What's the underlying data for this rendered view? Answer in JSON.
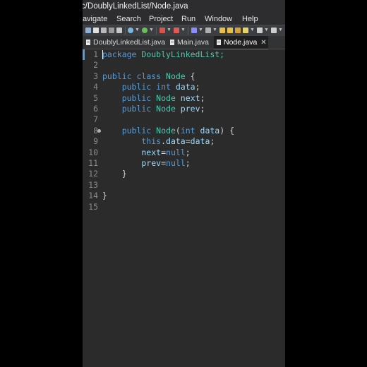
{
  "window": {
    "title": "c/DoublyLinkedList/Node.java"
  },
  "menu": [
    "Navigate",
    "Search",
    "Project",
    "Run",
    "Window",
    "Help"
  ],
  "tabs": [
    {
      "label": "DoublyLinkedList.java",
      "active": false
    },
    {
      "label": "Main.java",
      "active": false
    },
    {
      "label": "Node.java",
      "active": true,
      "close": "✕"
    }
  ],
  "toolbar": {
    "icons": [
      "save-icon",
      "new-icon",
      "open-icon",
      "print-icon",
      "build-icon",
      "run-icon",
      "debug-icon",
      "stop-icon",
      "search-icon",
      "edit-icon",
      "pen-icon"
    ]
  },
  "colors": {
    "keyword": "#569cd6",
    "type": "#4ec9b0",
    "field": "#9cdcfe",
    "plain": "#d4d4d4",
    "editor_bg": "#2b2b2b",
    "active_tab_accent": "#4a88c7"
  },
  "editor": {
    "line_numbers": [
      "1",
      "2",
      "3",
      "4",
      "5",
      "6",
      "7",
      "8",
      "9",
      "10",
      "11",
      "12",
      "13",
      "14",
      "15"
    ],
    "lines": [
      [
        {
          "t": "package ",
          "c": "kw"
        },
        {
          "t": "DoublyLinkedList;",
          "c": "ty"
        }
      ],
      [],
      [
        {
          "t": "public ",
          "c": "kw"
        },
        {
          "t": "class ",
          "c": "kw"
        },
        {
          "t": "Node ",
          "c": "ty"
        },
        {
          "t": "{",
          "c": "pl"
        }
      ],
      [
        {
          "t": "    public ",
          "c": "kw"
        },
        {
          "t": "int ",
          "c": "kw"
        },
        {
          "t": "data",
          "c": "fld"
        },
        {
          "t": ";",
          "c": "pl"
        }
      ],
      [
        {
          "t": "    public ",
          "c": "kw"
        },
        {
          "t": "Node ",
          "c": "ty"
        },
        {
          "t": "next",
          "c": "fld"
        },
        {
          "t": ";",
          "c": "pl"
        }
      ],
      [
        {
          "t": "    public ",
          "c": "kw"
        },
        {
          "t": "Node ",
          "c": "ty"
        },
        {
          "t": "prev",
          "c": "fld"
        },
        {
          "t": ";",
          "c": "pl"
        }
      ],
      [],
      [
        {
          "t": "    public ",
          "c": "kw"
        },
        {
          "t": "Node",
          "c": "ty"
        },
        {
          "t": "(",
          "c": "pl"
        },
        {
          "t": "int ",
          "c": "kw"
        },
        {
          "t": "data",
          "c": "fld"
        },
        {
          "t": ") {",
          "c": "pl"
        }
      ],
      [
        {
          "t": "        this",
          "c": "kw"
        },
        {
          "t": ".",
          "c": "pl"
        },
        {
          "t": "data",
          "c": "fld"
        },
        {
          "t": "=",
          "c": "pl"
        },
        {
          "t": "data",
          "c": "fld"
        },
        {
          "t": ";",
          "c": "pl"
        }
      ],
      [
        {
          "t": "        next",
          "c": "fld"
        },
        {
          "t": "=",
          "c": "pl"
        },
        {
          "t": "null",
          "c": "kw"
        },
        {
          "t": ";",
          "c": "pl"
        }
      ],
      [
        {
          "t": "        prev",
          "c": "fld"
        },
        {
          "t": "=",
          "c": "pl"
        },
        {
          "t": "null",
          "c": "kw"
        },
        {
          "t": ";",
          "c": "pl"
        }
      ],
      [
        {
          "t": "    }",
          "c": "pl"
        }
      ],
      [],
      [
        {
          "t": "}",
          "c": "pl"
        }
      ],
      []
    ]
  }
}
